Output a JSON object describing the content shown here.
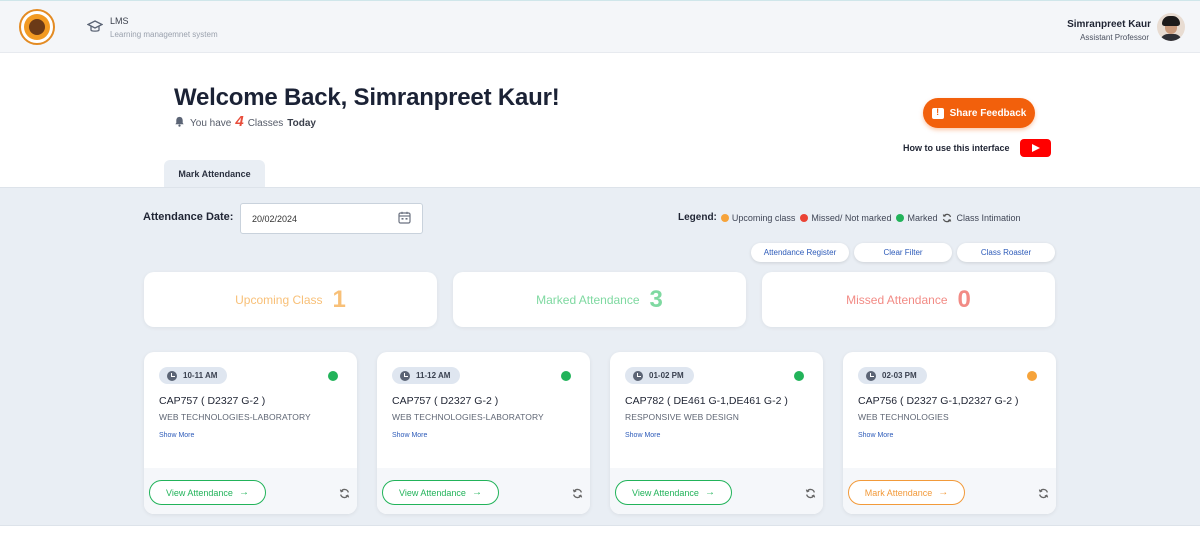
{
  "header": {
    "app_title": "LMS",
    "app_subtitle": "Learning managemnet system",
    "user_name": "Simranpreet Kaur",
    "user_role": "Assistant Professor"
  },
  "welcome": {
    "greeting": "Welcome Back, Simranpreet Kaur!",
    "prefix": "You have",
    "count": "4",
    "classes_word": "Classes",
    "today_word": "Today"
  },
  "actions": {
    "share_feedback": "Share Feedback",
    "how_to": "How to use this interface"
  },
  "tabs": [
    {
      "label": "Mark Attendance",
      "active": true
    }
  ],
  "attendance": {
    "date_label": "Attendance Date:",
    "date_value": "20/02/2024"
  },
  "legend": {
    "title": "Legend:",
    "items": [
      {
        "label": "Upcoming class",
        "color": "#f6a33a"
      },
      {
        "label": "Missed/ Not marked",
        "color": "#ea4335"
      },
      {
        "label": "Marked",
        "color": "#22b35a"
      },
      {
        "label": "Class Intimation",
        "icon": "sync-icon"
      }
    ]
  },
  "filters": [
    "Attendance Register",
    "Clear Filter",
    "Class Roaster"
  ],
  "stats": [
    {
      "label": "Upcoming Class",
      "value": "1",
      "color": "#f8c078"
    },
    {
      "label": "Marked Attendance",
      "value": "3",
      "color": "#7fd9a1"
    },
    {
      "label": "Missed Attendance",
      "value": "0",
      "color": "#f28b85"
    }
  ],
  "classes": [
    {
      "time": "10-11 AM",
      "course": "CAP757 ( D2327 G-2 )",
      "subject": "WEB TECHNOLOGIES-LABORATORY",
      "show_more": "Show More",
      "status_color": "#22b35a",
      "action": "View Attendance",
      "action_color": "#22b35a"
    },
    {
      "time": "11-12 AM",
      "course": "CAP757 ( D2327 G-2 )",
      "subject": "WEB TECHNOLOGIES-LABORATORY",
      "show_more": "Show More",
      "status_color": "#22b35a",
      "action": "View Attendance",
      "action_color": "#22b35a"
    },
    {
      "time": "01-02 PM",
      "course": "CAP782 ( DE461 G-1,DE461 G-2 )",
      "subject": "RESPONSIVE WEB DESIGN",
      "show_more": "Show More",
      "status_color": "#22b35a",
      "action": "View Attendance",
      "action_color": "#22b35a"
    },
    {
      "time": "02-03 PM",
      "course": "CAP756 ( D2327 G-1,D2327 G-2 )",
      "subject": "WEB TECHNOLOGIES",
      "show_more": "Show More",
      "status_color": "#f6a33a",
      "action": "Mark Attendance",
      "action_color": "#f29a3a"
    }
  ]
}
